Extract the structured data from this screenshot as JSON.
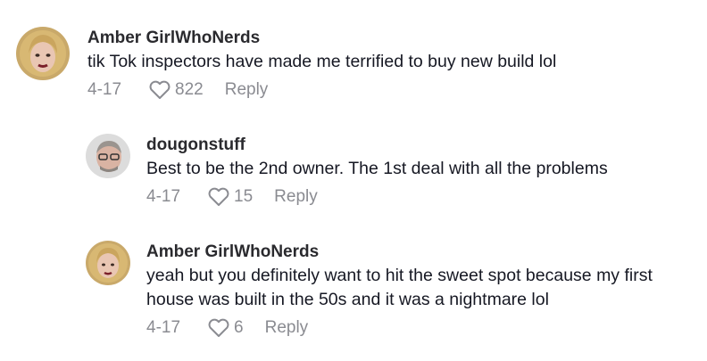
{
  "comments": [
    {
      "username": "Amber GirlWhoNerds",
      "text": "tik Tok inspectors have made me terrified to buy new build lol",
      "date": "4-17",
      "likes": "822",
      "reply_label": "Reply",
      "avatar_icon": "user-avatar-woman-blonde"
    },
    {
      "username": "dougonstuff",
      "text": "Best to be the 2nd owner. The 1st deal with all the problems",
      "date": "4-17",
      "likes": "15",
      "reply_label": "Reply",
      "avatar_icon": "user-avatar-man-glasses"
    },
    {
      "username": "Amber GirlWhoNerds",
      "text": "yeah but you definitely want to hit the sweet spot because my first house was built in the 50s and it was a nightmare lol",
      "date": "4-17",
      "likes": "6",
      "reply_label": "Reply",
      "avatar_icon": "user-avatar-woman-blonde"
    }
  ],
  "colors": {
    "text": "#161823",
    "username": "#2a2a2e",
    "meta": "#8a8b91"
  }
}
